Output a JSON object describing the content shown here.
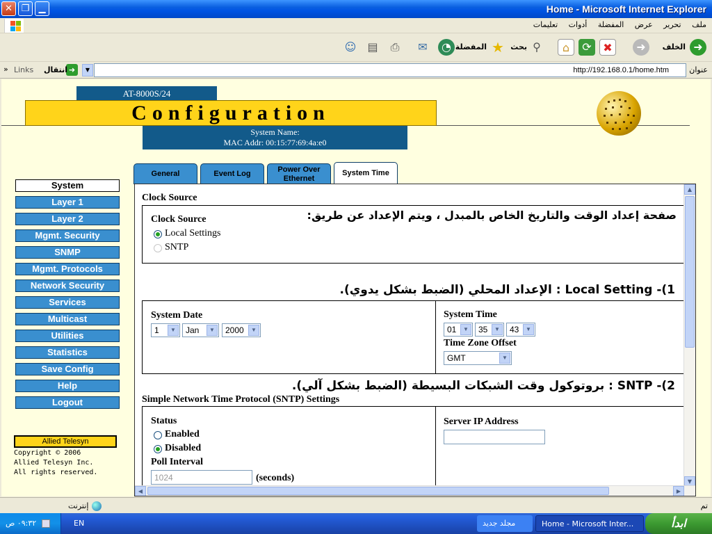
{
  "window": {
    "title": "Home - Microsoft Internet Explorer",
    "buttons": {
      "close": "✕",
      "restore": "❐",
      "minimize": "▁"
    }
  },
  "menubar": {
    "items": [
      "ملف",
      "تحرير",
      "عرض",
      "المفضلة",
      "أدوات",
      "تعليمات"
    ]
  },
  "toolbar": {
    "back_label": "الخلف",
    "search_label": "بحث",
    "favorites_label": "المفضلة"
  },
  "address": {
    "label": "عنوان",
    "url": "http://192.168.0.1/home.htm",
    "go_label": "انتقال",
    "links_label": "Links"
  },
  "header": {
    "model": "AT-8000S/24",
    "banner": "Configuration",
    "system_name": "System Name:",
    "mac_addr": "MAC Addr:  00:15:77:69:4a:e0"
  },
  "nav": {
    "items": [
      "System",
      "Layer 1",
      "Layer 2",
      "Mgmt. Security",
      "SNMP",
      "Mgmt. Protocols",
      "Network Security",
      "Services",
      "Multicast",
      "Utilities",
      "Statistics",
      "Save Config",
      "Help",
      "Logout"
    ],
    "active": "System"
  },
  "footer": {
    "logo": "Allied Telesyn",
    "copyright": "Copyright © 2006",
    "company": "Allied Telesyn Inc.",
    "rights": "All rights reserved."
  },
  "tabs": [
    {
      "label": "General"
    },
    {
      "label": "Event Log"
    },
    {
      "label1": "Power Over",
      "label2": "Ethernet"
    },
    {
      "label": "System Time"
    }
  ],
  "content": {
    "clock_source_title": "Clock Source",
    "clock_source_label": "Clock Source",
    "intro_note": "صفحة إعداد الوقت والتاريخ الخاص بالمبدل ، ويتم الإعداد عن طريق:",
    "option_local": "Local Settings",
    "option_sntp": "SNTP",
    "local_heading": "1)- Local Setting : الإعداد المحلي (الضبط بشكل يدوي).",
    "system_date_label": "System Date",
    "date": {
      "day": "1",
      "month": "Jan",
      "year": "2000"
    },
    "system_time_label": "System Time",
    "time": {
      "hour": "01",
      "minute": "35",
      "second": "43"
    },
    "tz_label": "Time Zone Offset",
    "tz_value": "GMT",
    "sntp_heading": "2)- SNTP : بروتوكول وقت الشبكات البسيطة (الضبط بشكل آلي).",
    "sntp_section_title": "Simple Network Time Protocol (SNTP) Settings",
    "status_label": "Status",
    "status_enabled": "Enabled",
    "status_disabled": "Disabled",
    "poll_label": "Poll Interval",
    "poll_value": "1024",
    "poll_unit": "(seconds)",
    "server_ip_label": "Server IP Address",
    "server_ip_value": ""
  },
  "statusbar": {
    "done": "تم",
    "zone": "إنترنت"
  },
  "taskbar": {
    "start": "ابدأ",
    "tasks": [
      "Home - Microsoft Inter...",
      "مجلد جديد"
    ],
    "lang": "EN",
    "clock": "٠٩:٣٢ ص"
  }
}
